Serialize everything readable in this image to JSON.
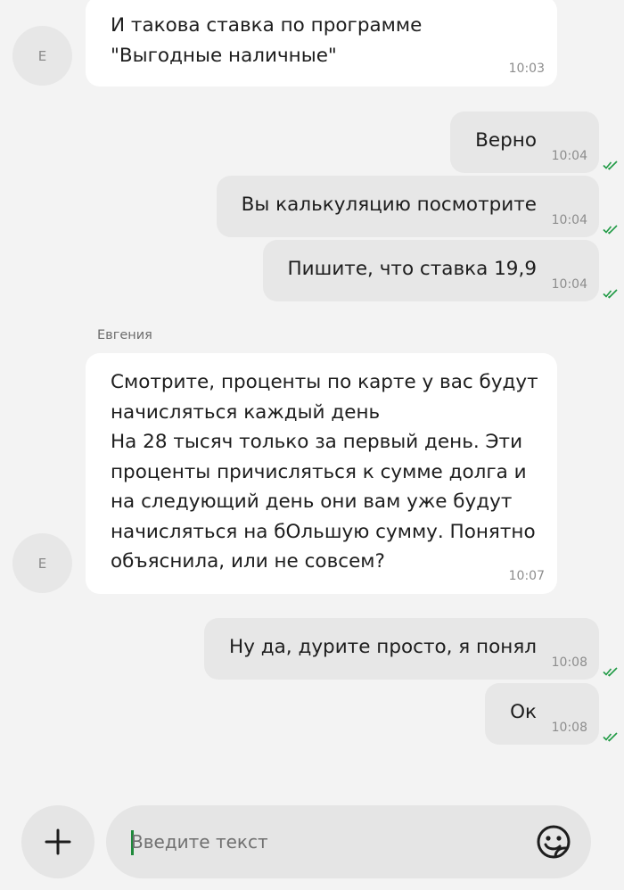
{
  "chat": {
    "messages": [
      {
        "direction": "in",
        "avatar": "Е",
        "text": "И такова ставка по программе\n\"Выгодные наличные\"",
        "time": "10:03"
      },
      {
        "direction": "out",
        "text": "Верно",
        "time": "10:04",
        "status": "read"
      },
      {
        "direction": "out",
        "text": "Вы калькуляцию посмотрите",
        "time": "10:04",
        "status": "read"
      },
      {
        "direction": "out",
        "text": "Пишите, что ставка 19,9",
        "time": "10:04",
        "status": "read"
      },
      {
        "direction": "in",
        "sender": "Евгения",
        "avatar": "Е",
        "text": "Смотрите, проценты по карте у вас будут начисляться каждый день\nНа 28 тысяч только за первый день. Эти проценты причисляться к сумме долга и на следующий день они вам уже будут начисляться на бОльшую сумму. Понятно объяснила, или не совсем?",
        "time": "10:07"
      },
      {
        "direction": "out",
        "text": "Ну да, дурите просто, я понял",
        "time": "10:08",
        "status": "read"
      },
      {
        "direction": "out",
        "text": "Ок",
        "time": "10:08",
        "status": "read"
      }
    ]
  },
  "composer": {
    "placeholder": "Введите текст",
    "value": "",
    "attach_icon": "plus-icon",
    "emoji_icon": "sticker-emoji-icon"
  },
  "colors": {
    "background": "#f3f3f3",
    "incoming_bubble": "#ffffff",
    "outgoing_bubble": "#e7e7e7",
    "read_check": "#1f9a44",
    "caret": "#1f8a3b"
  }
}
